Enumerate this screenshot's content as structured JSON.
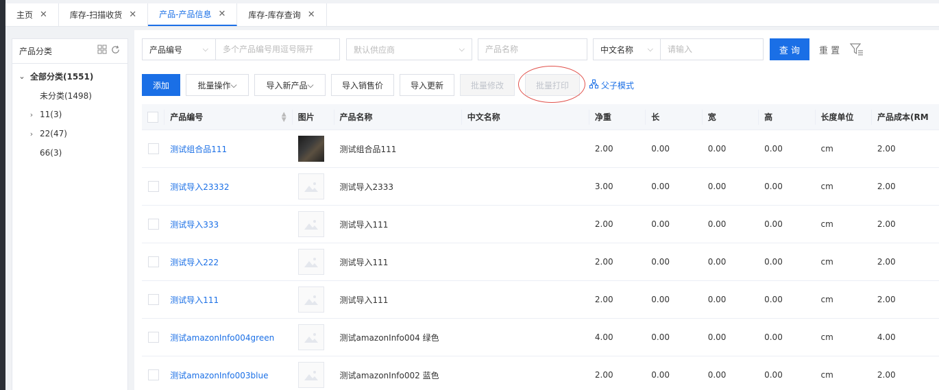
{
  "tabs": [
    {
      "label": "主页",
      "active": false
    },
    {
      "label": "库存-扫描收货",
      "active": false
    },
    {
      "label": "产品-产品信息",
      "active": true
    },
    {
      "label": "库存-库存查询",
      "active": false
    }
  ],
  "sidebar": {
    "title": "产品分类",
    "tree": [
      {
        "label": "全部分类(1551)",
        "expanded": true
      },
      {
        "label": "未分类(1498)"
      },
      {
        "label": "11(3)",
        "expandable": true
      },
      {
        "label": "22(47)",
        "expandable": true
      },
      {
        "label": "66(3)"
      }
    ]
  },
  "filters": {
    "field_select": "产品编号",
    "codes_placeholder": "多个产品编号用逗号隔开",
    "supplier_placeholder": "默认供应商",
    "product_name_placeholder": "产品名称",
    "lang_select": "中文名称",
    "keyword_placeholder": "请输入",
    "query_label": "查 询",
    "reset_label": "重 置"
  },
  "actions": {
    "add": "添加",
    "batch_ops": "批量操作",
    "import_new": "导入新产品",
    "import_price": "导入销售价",
    "import_update": "导入更新",
    "batch_edit": "批量修改",
    "batch_print": "批量打印",
    "parent_child": "父子模式"
  },
  "table": {
    "columns": [
      "产品编号",
      "图片",
      "产品名称",
      "中文名称",
      "净重",
      "长",
      "宽",
      "高",
      "长度单位",
      "产品成本(RM"
    ],
    "rows": [
      {
        "code": "测试组合品111",
        "has_photo": true,
        "name": "测试组合品111",
        "cn_name": "",
        "weight": "2.00",
        "length": "0.00",
        "width": "0.00",
        "height": "0.00",
        "unit": "cm",
        "cost": "2.00"
      },
      {
        "code": "测试导入23332",
        "has_photo": false,
        "name": "测试导入2333",
        "cn_name": "",
        "weight": "3.00",
        "length": "0.00",
        "width": "0.00",
        "height": "0.00",
        "unit": "cm",
        "cost": "2.00"
      },
      {
        "code": "测试导入333",
        "has_photo": false,
        "name": "测试导入111",
        "cn_name": "",
        "weight": "2.00",
        "length": "0.00",
        "width": "0.00",
        "height": "0.00",
        "unit": "cm",
        "cost": "2.00"
      },
      {
        "code": "测试导入222",
        "has_photo": false,
        "name": "测试导入111",
        "cn_name": "",
        "weight": "2.00",
        "length": "0.00",
        "width": "0.00",
        "height": "0.00",
        "unit": "cm",
        "cost": "2.00"
      },
      {
        "code": "测试导入111",
        "has_photo": false,
        "name": "测试导入111",
        "cn_name": "",
        "weight": "2.00",
        "length": "0.00",
        "width": "0.00",
        "height": "0.00",
        "unit": "cm",
        "cost": "2.00"
      },
      {
        "code": "测试amazonInfo004green",
        "has_photo": false,
        "name": "测试amazonInfo004 绿色",
        "cn_name": "",
        "weight": "4.00",
        "length": "0.00",
        "width": "0.00",
        "height": "0.00",
        "unit": "cm",
        "cost": "4.00"
      },
      {
        "code": "测试amazonInfo003blue",
        "has_photo": false,
        "name": "测试amazonInfo002 蓝色",
        "cn_name": "",
        "weight": "2.00",
        "length": "0.00",
        "width": "0.00",
        "height": "0.00",
        "unit": "cm",
        "cost": "2.00"
      }
    ]
  },
  "colors": {
    "accent": "#1a6fe6",
    "annotation": "#e0504a"
  }
}
